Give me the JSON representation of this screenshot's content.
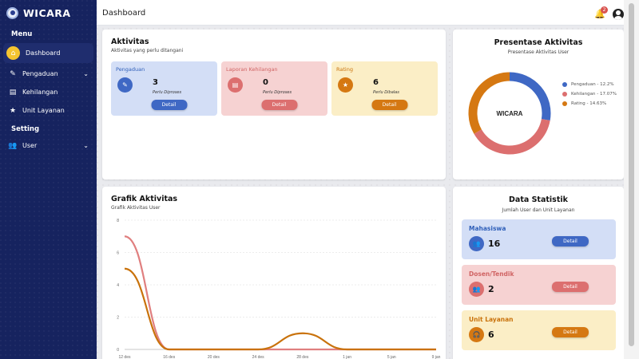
{
  "brand": {
    "name": "WICARA"
  },
  "sidebar": {
    "menu_label": "Menu",
    "setting_label": "Setting",
    "items": [
      {
        "label": "Dashboard",
        "icon": "home-icon"
      },
      {
        "label": "Pengaduan",
        "icon": "edit-icon"
      },
      {
        "label": "Kehilangan",
        "icon": "document-icon"
      },
      {
        "label": "Unit Layanan",
        "icon": "star-icon"
      }
    ],
    "settings_items": [
      {
        "label": "User",
        "icon": "users-icon"
      }
    ]
  },
  "header": {
    "title": "Dashboard",
    "notification_count": "2"
  },
  "aktivitas": {
    "title": "Aktivitas",
    "subtitle": "Aktivitas yang perlu ditangani",
    "cards": [
      {
        "label": "Pengaduan",
        "value": "3",
        "note": "Perlu Diproses",
        "button": "Detail",
        "icon": "edit-icon"
      },
      {
        "label": "Laporan Kehilangan",
        "value": "0",
        "note": "Perlu Diproses",
        "button": "Detail",
        "icon": "document-icon"
      },
      {
        "label": "Rating",
        "value": "6",
        "note": "Perlu Dibalas",
        "button": "Detail",
        "icon": "star-icon"
      }
    ]
  },
  "presentase": {
    "title": "Presentase Aktivitas",
    "subtitle": "Presentase Aktivitas User",
    "center_label": "WICARA",
    "colors": [
      "#3f68c4",
      "#dc6f6f",
      "#d57812"
    ],
    "legend": [
      {
        "label": "Pengaduan - 12.2%",
        "color": "#3f68c4"
      },
      {
        "label": "Kehilangan - 17.07%",
        "color": "#dc6f6f"
      },
      {
        "label": "Rating - 14.63%",
        "color": "#d57812"
      }
    ]
  },
  "grafik": {
    "title": "Grafik Aktivitas",
    "subtitle": "Grafik Aktivitas User"
  },
  "chart_data": {
    "type": "line",
    "ylim": [
      0,
      8
    ],
    "yticks": [
      "8",
      "6",
      "4",
      "2",
      "0"
    ],
    "x": [
      "12 des",
      "16 des",
      "20 des",
      "24 des",
      "28 des",
      "1 jan",
      "5 jan",
      "9 jan"
    ],
    "series": [
      {
        "color": "#e07f7f",
        "values": [
          7,
          0,
          0,
          0,
          0,
          0,
          0,
          0
        ]
      },
      {
        "color": "#c9720b",
        "values": [
          5,
          0,
          0,
          0,
          1,
          0,
          0,
          0
        ]
      }
    ],
    "grid": true
  },
  "statistik": {
    "title": "Data Statistik",
    "subtitle": "Jumlah User dan Unit Layanan",
    "items": [
      {
        "label": "Mahasiswa",
        "value": "16",
        "button": "Detail",
        "icon": "users-icon"
      },
      {
        "label": "Dosen/Tendik",
        "value": "2",
        "button": "Detail",
        "icon": "users-icon"
      },
      {
        "label": "Unit Layanan",
        "value": "6",
        "button": "Detail",
        "icon": "headset-icon"
      }
    ]
  }
}
